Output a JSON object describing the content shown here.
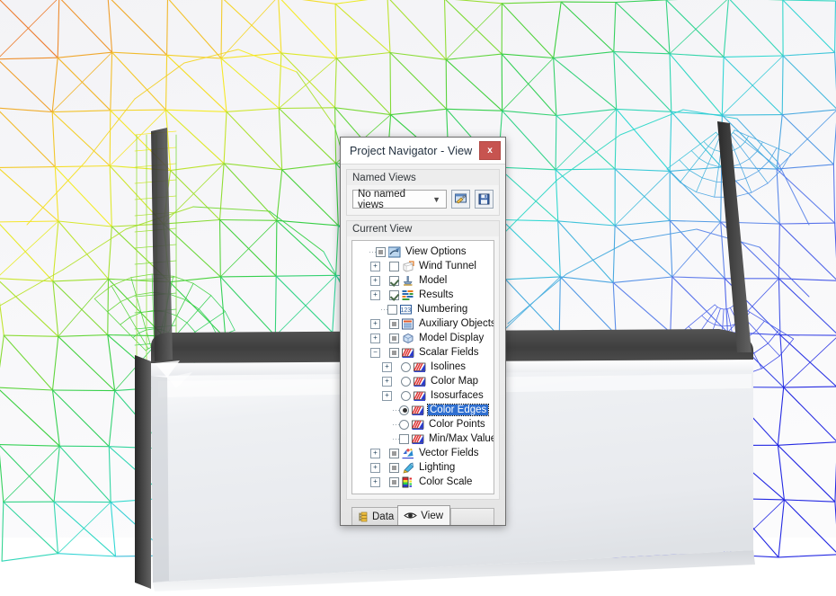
{
  "window": {
    "title": "Project Navigator - View",
    "close_label": "x",
    "close_icon": "close-icon"
  },
  "named_views": {
    "group_title": "Named Views",
    "combo_value": "No named views",
    "combo_chevron": "chevron-down-icon",
    "buttons": [
      {
        "name": "manage-views-button",
        "icon": "edit-view-icon"
      },
      {
        "name": "save-view-button",
        "icon": "floppy-disk-icon"
      }
    ]
  },
  "current_view": {
    "group_title": "Current View",
    "tree": [
      {
        "label": "View Options",
        "depth": 0,
        "expander": "none",
        "control": "checkbox",
        "state": "partial",
        "icon": "view-options-icon",
        "selected": false
      },
      {
        "label": "Wind Tunnel",
        "depth": 1,
        "expander": "plus",
        "control": "checkbox",
        "state": "unchecked",
        "icon": "wind-tunnel-icon",
        "selected": false
      },
      {
        "label": "Model",
        "depth": 1,
        "expander": "plus",
        "control": "checkbox",
        "state": "checked",
        "icon": "model-icon",
        "selected": false
      },
      {
        "label": "Results",
        "depth": 1,
        "expander": "plus",
        "control": "checkbox",
        "state": "checked",
        "icon": "results-icon",
        "selected": false
      },
      {
        "label": "Numbering",
        "depth": 1,
        "expander": "none",
        "control": "checkbox",
        "state": "unchecked",
        "icon": "numbering-icon",
        "selected": false
      },
      {
        "label": "Auxiliary Objects",
        "depth": 1,
        "expander": "plus",
        "control": "checkbox",
        "state": "partial",
        "icon": "auxiliary-objects-icon",
        "selected": false
      },
      {
        "label": "Model Display",
        "depth": 1,
        "expander": "plus",
        "control": "checkbox",
        "state": "partial",
        "icon": "model-display-icon",
        "selected": false
      },
      {
        "label": "Scalar Fields",
        "depth": 1,
        "expander": "minus",
        "control": "checkbox",
        "state": "partial",
        "icon": "scalar-fields-icon",
        "selected": false
      },
      {
        "label": "Isolines",
        "depth": 2,
        "expander": "plus",
        "control": "radio",
        "state": "off",
        "icon": "scalar-fields-icon",
        "selected": false
      },
      {
        "label": "Color Map",
        "depth": 2,
        "expander": "plus",
        "control": "radio",
        "state": "off",
        "icon": "scalar-fields-icon",
        "selected": false
      },
      {
        "label": "Isosurfaces",
        "depth": 2,
        "expander": "plus",
        "control": "radio",
        "state": "off",
        "icon": "scalar-fields-icon",
        "selected": false
      },
      {
        "label": "Color Edges",
        "depth": 2,
        "expander": "none",
        "control": "radio",
        "state": "on",
        "icon": "scalar-fields-icon",
        "selected": true
      },
      {
        "label": "Color Points",
        "depth": 2,
        "expander": "none",
        "control": "radio",
        "state": "off",
        "icon": "scalar-fields-icon",
        "selected": false
      },
      {
        "label": "Min/Max Values",
        "depth": 2,
        "expander": "none",
        "control": "checkbox",
        "state": "unchecked",
        "icon": "scalar-fields-icon",
        "selected": false
      },
      {
        "label": "Vector Fields",
        "depth": 1,
        "expander": "plus",
        "control": "checkbox",
        "state": "partial",
        "icon": "vector-fields-icon",
        "selected": false
      },
      {
        "label": "Lighting",
        "depth": 1,
        "expander": "plus",
        "control": "checkbox",
        "state": "partial",
        "icon": "lighting-icon",
        "selected": false
      },
      {
        "label": "Color Scale",
        "depth": 1,
        "expander": "plus",
        "control": "checkbox",
        "state": "partial",
        "icon": "color-scale-icon",
        "selected": false
      }
    ]
  },
  "tabs": [
    {
      "label": "Data",
      "icon": "data-tree-icon",
      "active": false
    },
    {
      "label": "View",
      "icon": "eye-icon",
      "active": true
    }
  ],
  "colors": {
    "selection_blue": "#2f6fd0",
    "close_red": "#c75450",
    "title_text": "#22303f",
    "mesh_warm": "#ffe000",
    "mesh_cool": "#1a1ae0",
    "object_white": "#eceef1",
    "object_dark": "#4a4a4a"
  },
  "viewport": {
    "name": "fem-mesh-3d-viewport",
    "description": "Colored finite-element wireframe mesh behind a white bracket-shaped solid"
  }
}
